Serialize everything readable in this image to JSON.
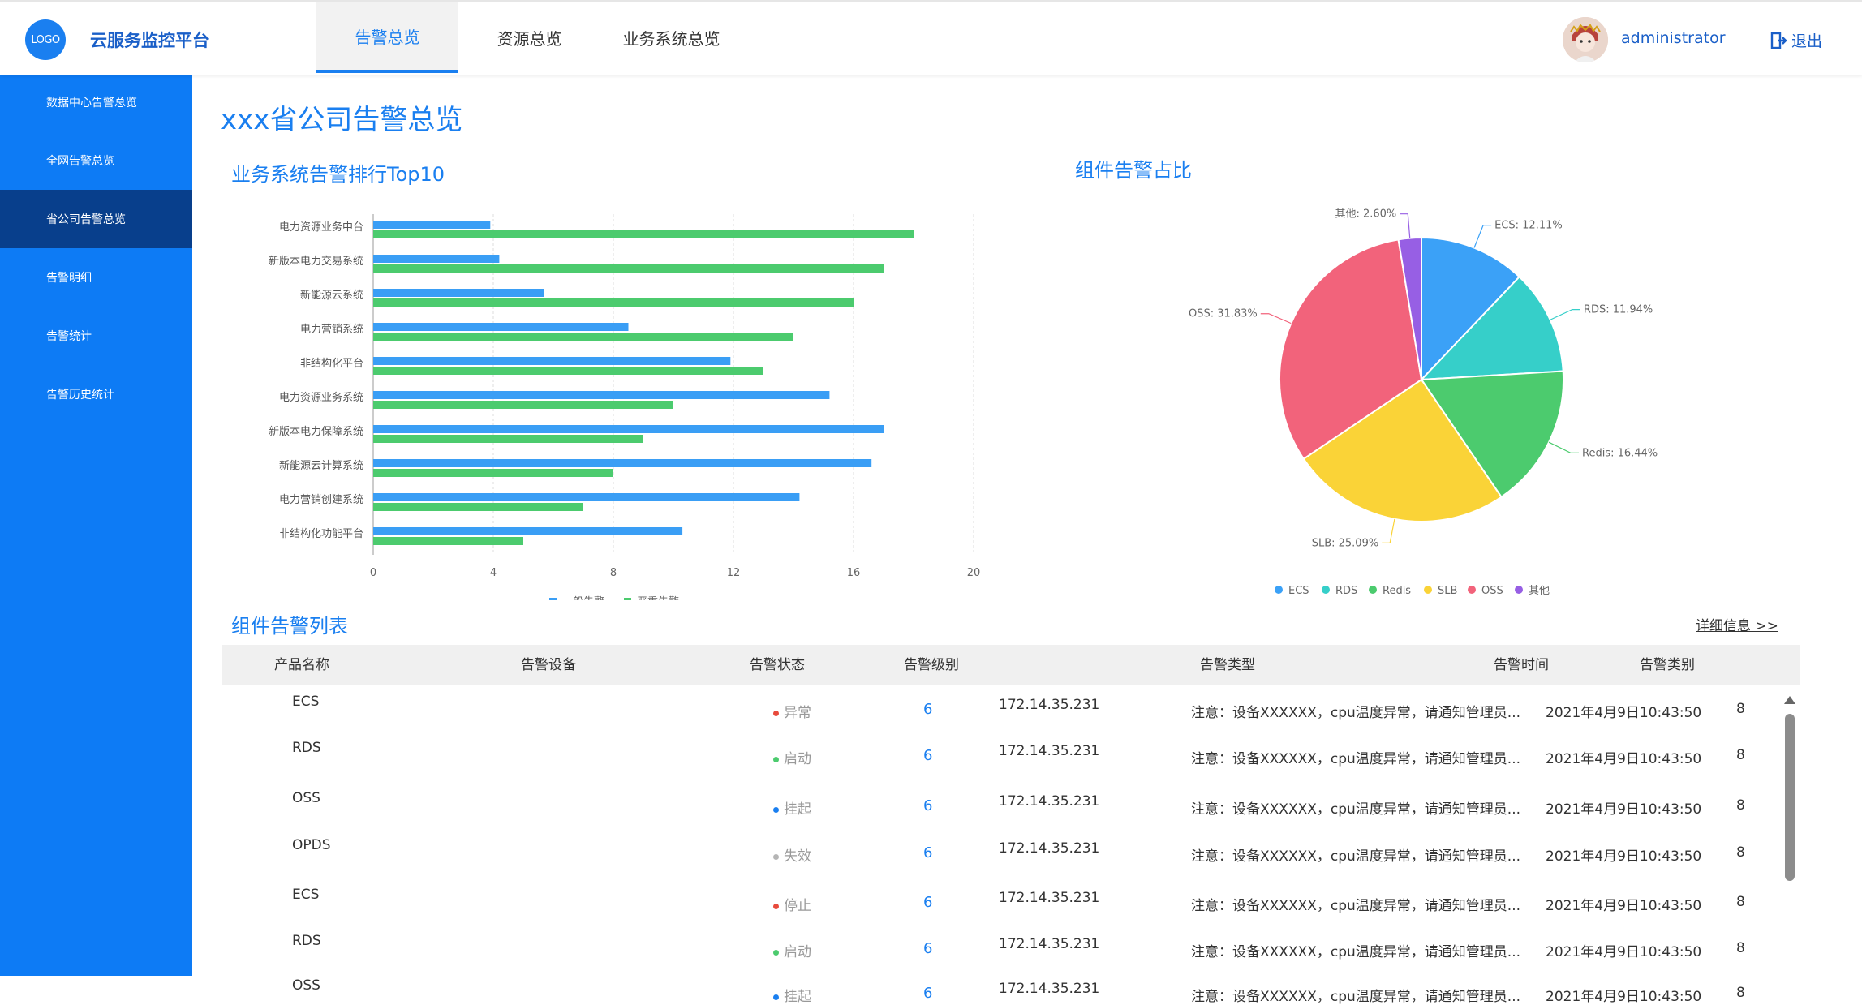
{
  "header": {
    "logo_text": "LOGO",
    "app_name": "云服务监控平台",
    "tabs": [
      "告警总览",
      "资源总览",
      "业务系统总览"
    ],
    "active_tab": "告警总览",
    "username": "administrator",
    "logout_label": "退出"
  },
  "sidebar": {
    "items": [
      "数据中心告警总览",
      "全网告警总览",
      "省公司告警总览",
      "告警明细",
      "告警统计",
      "告警历史统计"
    ],
    "active_item": "省公司告警总览"
  },
  "page_title": "xxx省公司告警总览",
  "bar_section_title": "业务系统告警排行Top10",
  "pie_section_title": "组件告警占比",
  "list_section_title": "组件告警列表",
  "detail_link": "详细信息 >>",
  "colors": {
    "primary": "#1a7ff0",
    "sidebar": "#0d7bf5",
    "sidebar_active": "#083f8c",
    "status_abnormal": "#e84a3c",
    "status_started": "#4ccb6e",
    "status_suspended": "#1a7ff0",
    "status_invalid": "#b5b5b5",
    "status_stopped": "#e84a3c"
  },
  "chart_data": [
    {
      "type": "bar",
      "orientation": "horizontal",
      "categories": [
        "电力资源业务中台",
        "新版本电力交易系统",
        "新能源云系统",
        "电力营销系统",
        "非结构化平台",
        "电力资源业务系统",
        "新版本电力保障系统",
        "新能源云计算系统",
        "电力营销创建系统",
        "非结构化功能平台"
      ],
      "series": [
        {
          "name": "一般告警",
          "color": "#3a9ef5",
          "values": [
            3.9,
            4.2,
            5.7,
            8.5,
            11.9,
            15.2,
            17.0,
            16.6,
            14.2,
            10.3
          ]
        },
        {
          "name": "严重告警",
          "color": "#4ccb6e",
          "values": [
            18.0,
            17.0,
            16.0,
            14.0,
            13.0,
            10.0,
            9.0,
            8.0,
            7.0,
            5.0
          ]
        }
      ],
      "xticks": [
        "0",
        "4",
        "8",
        "12",
        "16",
        "20"
      ],
      "xlim": [
        0,
        20
      ],
      "grid": "vertical dashed",
      "legend": "bottom-center"
    },
    {
      "type": "pie",
      "slices": [
        {
          "label": "ECS",
          "value": 12.11,
          "text": "ECS: 12.11%",
          "color": "#3ba1f7"
        },
        {
          "label": "RDS",
          "value": 11.94,
          "text": "RDS: 11.94%",
          "color": "#36cfc9"
        },
        {
          "label": "Redis",
          "value": 16.44,
          "text": "Redis: 16.44%",
          "color": "#4ccb6e"
        },
        {
          "label": "SLB",
          "value": 25.09,
          "text": "SLB: 25.09%",
          "color": "#fad337"
        },
        {
          "label": "OSS",
          "value": 31.83,
          "text": "OSS: 31.83%",
          "color": "#f2637b"
        },
        {
          "label": "其他",
          "value": 2.6,
          "text": "其他: 2.60%",
          "color": "#975fe4"
        }
      ],
      "legend": "bottom-center"
    }
  ],
  "table": {
    "columns": [
      "产品名称",
      "告警设备",
      "告警状态",
      "告警级别",
      "告警类型",
      "告警时间",
      "告警类别"
    ],
    "rows": [
      {
        "product": "ECS",
        "status": "异常",
        "status_key": "status_abnormal",
        "level": "6",
        "ip": "172.14.35.231",
        "type": "注意：设备XXXXXX，cpu温度异常，请通知管理员...",
        "time": "2021年4月9日10:43:50",
        "category": "8"
      },
      {
        "product": "RDS",
        "status": "启动",
        "status_key": "status_started",
        "level": "6",
        "ip": "172.14.35.231",
        "type": "注意：设备XXXXXX，cpu温度异常，请通知管理员...",
        "time": "2021年4月9日10:43:50",
        "category": "8"
      },
      {
        "product": "OSS",
        "status": "挂起",
        "status_key": "status_suspended",
        "level": "6",
        "ip": "172.14.35.231",
        "type": "注意：设备XXXXXX，cpu温度异常，请通知管理员...",
        "time": "2021年4月9日10:43:50",
        "category": "8"
      },
      {
        "product": "OPDS",
        "status": "失效",
        "status_key": "status_invalid",
        "level": "6",
        "ip": "172.14.35.231",
        "type": "注意：设备XXXXXX，cpu温度异常，请通知管理员...",
        "time": "2021年4月9日10:43:50",
        "category": "8"
      },
      {
        "product": "ECS",
        "status": "停止",
        "status_key": "status_stopped",
        "level": "6",
        "ip": "172.14.35.231",
        "type": "注意：设备XXXXXX，cpu温度异常，请通知管理员...",
        "time": "2021年4月9日10:43:50",
        "category": "8"
      },
      {
        "product": "RDS",
        "status": "启动",
        "status_key": "status_started",
        "level": "6",
        "ip": "172.14.35.231",
        "type": "注意：设备XXXXXX，cpu温度异常，请通知管理员...",
        "time": "2021年4月9日10:43:50",
        "category": "8"
      },
      {
        "product": "OSS",
        "status": "挂起",
        "status_key": "status_suspended",
        "level": "6",
        "ip": "172.14.35.231",
        "type": "注意：设备XXXXXX，cpu温度异常，请通知管理员...",
        "time": "2021年4月9日10:43:50",
        "category": "8"
      }
    ]
  }
}
